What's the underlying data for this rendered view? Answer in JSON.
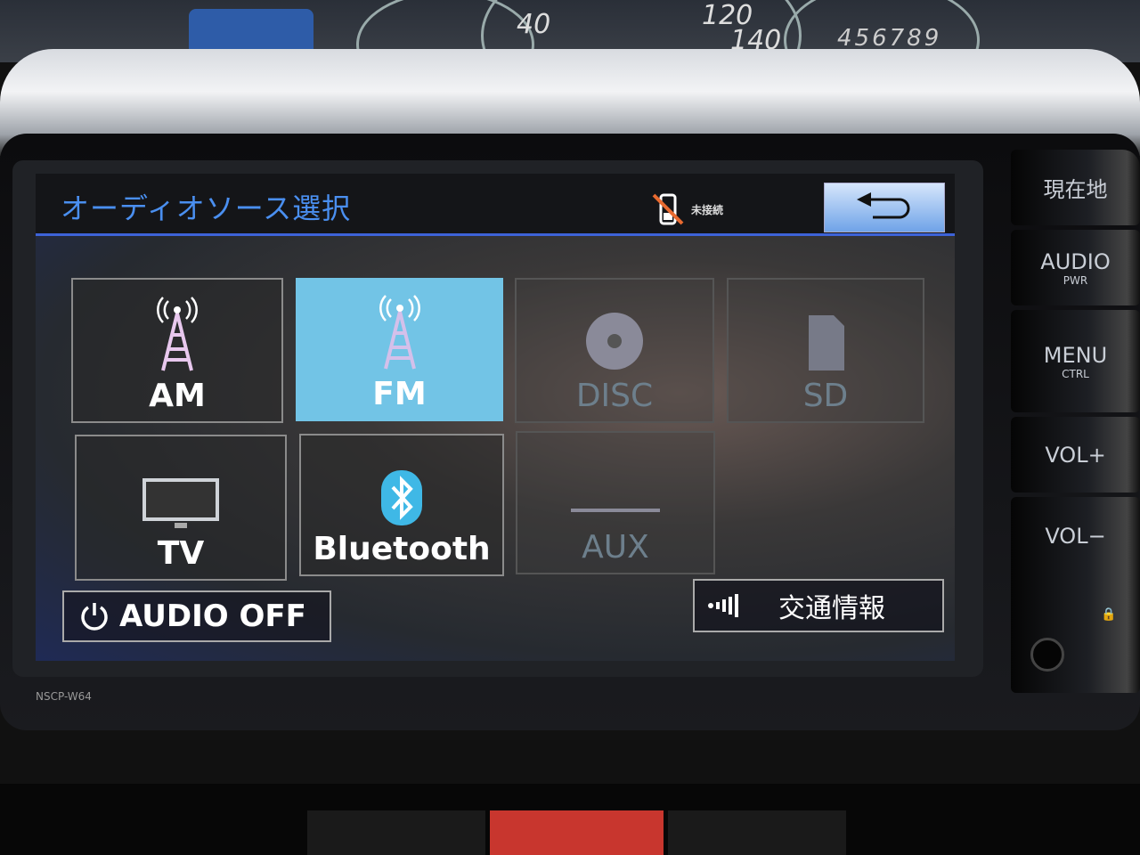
{
  "cluster": {
    "speed_labels": [
      "40",
      "120",
      "140"
    ],
    "odometer": "456789"
  },
  "header": {
    "title": "オーディオソース選択",
    "bt_status": "未接続",
    "back_icon": "return-arrow-icon"
  },
  "sources": [
    {
      "label": "AM",
      "icon": "antenna-tower-icon",
      "state": "enabled"
    },
    {
      "label": "FM",
      "icon": "antenna-tower-icon",
      "state": "selected"
    },
    {
      "label": "DISC",
      "icon": "disc-icon",
      "state": "disabled"
    },
    {
      "label": "SD",
      "icon": "sd-card-icon",
      "state": "disabled"
    },
    {
      "label": "TV",
      "icon": "tv-icon",
      "state": "enabled"
    },
    {
      "label": "Bluetooth",
      "icon": "bluetooth-icon",
      "state": "enabled"
    },
    {
      "label": "AUX",
      "icon": "aux-icon",
      "state": "disabled"
    }
  ],
  "footer": {
    "audio_off": "AUDIO OFF",
    "traffic": "交通情報"
  },
  "hardware": {
    "buttons": [
      {
        "label": "現在地"
      },
      {
        "label": "AUDIO",
        "sub": "PWR"
      },
      {
        "label": "MENU",
        "sub": "CTRL"
      },
      {
        "label": "VOL+"
      },
      {
        "label": "VOL−"
      }
    ],
    "model": "NSCP-W64"
  },
  "colors": {
    "accent": "#3d63d8",
    "selected": "#72c4e6",
    "title": "#4a8ff0"
  }
}
